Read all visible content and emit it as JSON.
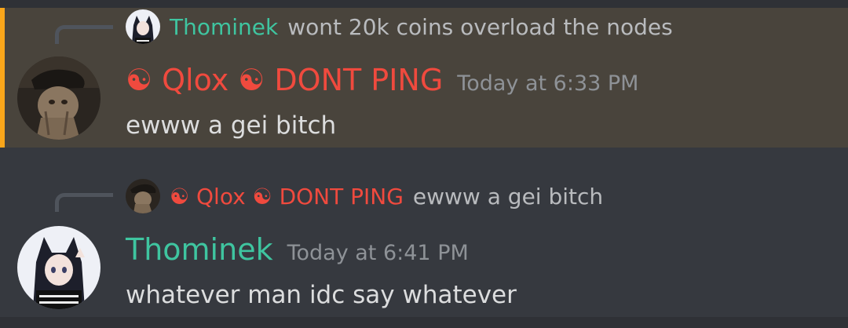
{
  "colors": {
    "thominek": "#3fc5a0",
    "qlox": "#f04a3e",
    "mention_highlight": "#faa61a"
  },
  "messages": [
    {
      "reply": {
        "author": "Thominek",
        "text": "wont 20k coins overload the nodes",
        "avatar_icon": "anime-avatar-icon"
      },
      "author": "☯ Qlox ☯ DONT PING",
      "timestamp": "Today at 6:33 PM",
      "content": "ewww a gei bitch",
      "avatar_icon": "cat-with-hat-avatar-icon",
      "mentioned": true
    },
    {
      "reply": {
        "author": "☯ Qlox ☯ DONT PING",
        "text": "ewww a gei bitch",
        "avatar_icon": "cat-with-hat-avatar-icon"
      },
      "author": "Thominek",
      "timestamp": "Today at 6:41 PM",
      "content": "whatever man idc say whatever",
      "avatar_icon": "anime-avatar-icon",
      "mentioned": false
    }
  ]
}
